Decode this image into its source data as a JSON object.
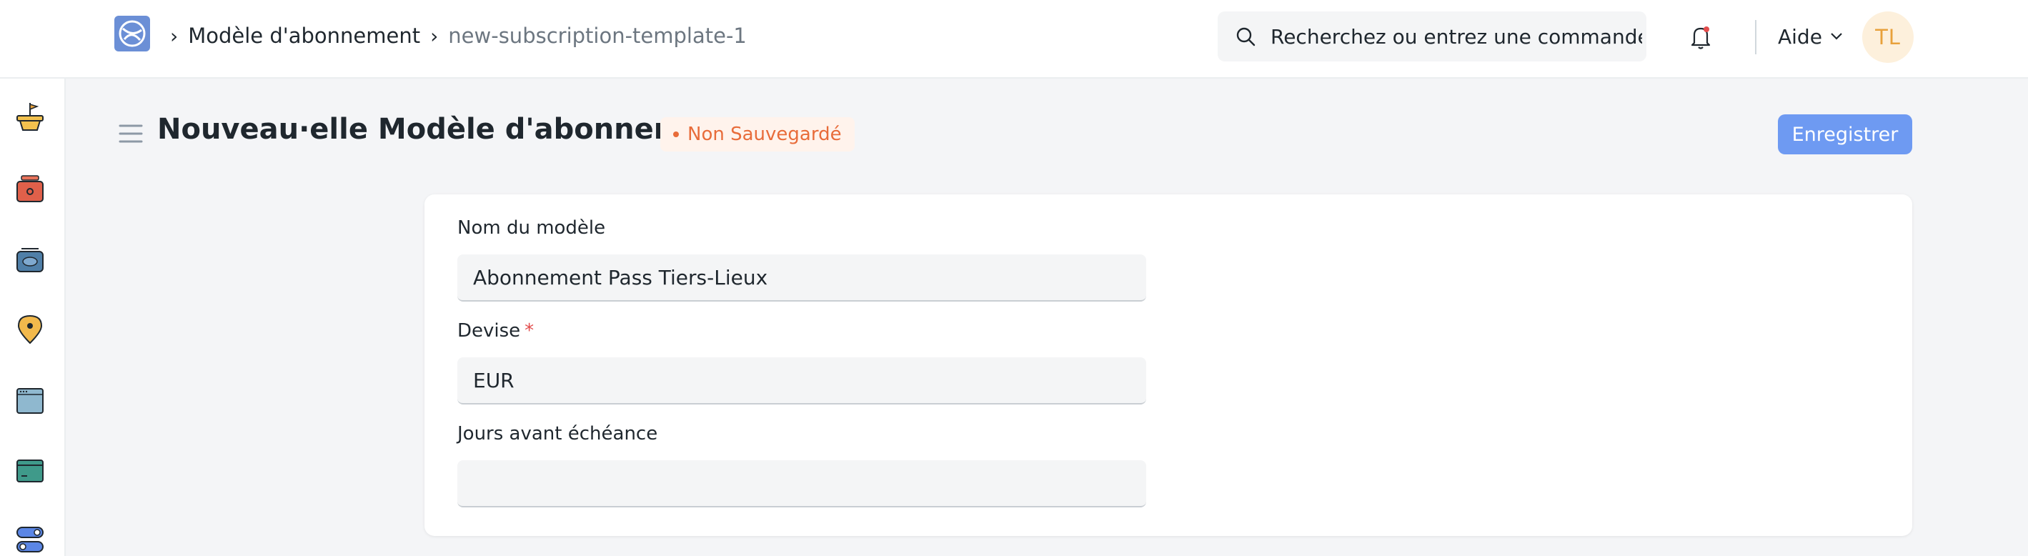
{
  "navbar": {
    "breadcrumb": [
      {
        "label": "Modèle d'abonnement"
      },
      {
        "label": "new-subscription-template-1"
      }
    ],
    "search": {
      "placeholder": "Recherchez ou entrez une commande"
    },
    "help_label": "Aide",
    "avatar_initials": "TL"
  },
  "sidebar": {
    "icons": [
      {
        "name": "plant-pot-icon"
      },
      {
        "name": "register-icon"
      },
      {
        "name": "tray-icon"
      },
      {
        "name": "location-pin-icon"
      },
      {
        "name": "window-icon"
      },
      {
        "name": "card-icon"
      },
      {
        "name": "toggle-icon"
      }
    ]
  },
  "page": {
    "title": "Nouveau·elle Modèle d'abonnement",
    "status": "Non Sauvegardé",
    "save_label": "Enregistrer"
  },
  "form": {
    "fields": [
      {
        "label": "Nom du modèle",
        "value": "Abonnement Pass Tiers-Lieux",
        "required": false
      },
      {
        "label": "Devise",
        "required_mark": "*",
        "value": "EUR",
        "required": true
      },
      {
        "label": "Jours avant échéance",
        "value": "",
        "required": false
      }
    ]
  },
  "colors": {
    "accent": "#6e9af2",
    "status_orange": "#e86c3a",
    "avatar_bg": "#fdf0dc",
    "avatar_fg": "#e8a13b"
  }
}
